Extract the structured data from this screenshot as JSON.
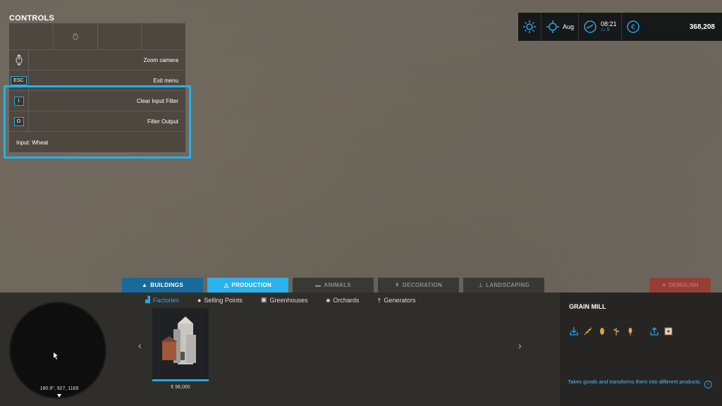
{
  "controls": {
    "title": "CONTROLS",
    "rows": [
      {
        "key": "",
        "label": "Zoom camera"
      },
      {
        "key": "ESC",
        "label": "Exit menu"
      },
      {
        "key": "I",
        "label": "Clear Input Filter"
      },
      {
        "key": "O",
        "label": "Filter Output"
      }
    ],
    "input_filter": "Input: Wheat"
  },
  "hud": {
    "month": "Aug",
    "time": "08:21",
    "speed": "5",
    "money": "368,208"
  },
  "tabs": [
    {
      "label": "BUILDINGS",
      "icon": "house-icon"
    },
    {
      "label": "PRODUCTION",
      "icon": "factory-icon"
    },
    {
      "label": "ANIMALS",
      "icon": "cow-icon"
    },
    {
      "label": "DECORATION",
      "icon": "lamp-icon"
    },
    {
      "label": "LANDSCAPING",
      "icon": "shovel-icon"
    }
  ],
  "demolish_label": "DEMOLISH",
  "subtabs": [
    {
      "label": "Factories",
      "icon": "factory-icon"
    },
    {
      "label": "Selling Points",
      "icon": "euro-icon"
    },
    {
      "label": "Greenhouses",
      "icon": "greenhouse-icon"
    },
    {
      "label": "Orchards",
      "icon": "tree-icon"
    },
    {
      "label": "Generators",
      "icon": "wind-turbine-icon"
    }
  ],
  "minimap": {
    "coords": "180.9°, 927, 1169"
  },
  "item": {
    "price": "€ 96,000"
  },
  "info": {
    "title": "GRAIN MILL",
    "description": "Takes goods and transforms them into different products."
  },
  "colors": {
    "accent": "#29a7e0",
    "buildings_tab": "#176a9a",
    "production_tab": "#2ab2ee",
    "demolish": "#a4322a"
  }
}
